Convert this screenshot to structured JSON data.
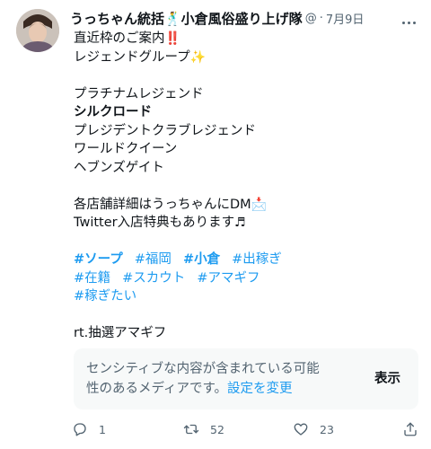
{
  "tweet": {
    "author": {
      "display_name": "うっちゃん統括🕺小倉風俗盛り上げ隊",
      "handle": "@",
      "separator": "·",
      "date": "7月9日"
    },
    "lines": {
      "l1": "直近枠のご案内",
      "l1_emoji": "‼️",
      "l2": "レジェンドグループ",
      "l2_emoji": "✨",
      "l3": "プラチナムレジェンド",
      "l4": "シルクロード",
      "l5": "プレジデントクラブレジェンド",
      "l6": "ワールドクイーン",
      "l7": "ヘブンズゲイト",
      "l8": "各店舗詳細はうっちゃんにDM",
      "l8_emoji": "📩",
      "l9": "Twitter入店特典もあります",
      "l9_emoji": "♬",
      "l10": "rt.抽選アマギフ"
    },
    "hashtags": {
      "row1": [
        "#ソープ",
        "#福岡",
        "#小倉",
        "#出稼ぎ"
      ],
      "row2": [
        "#在籍",
        "#スカウト",
        "#アマギフ"
      ],
      "row3": [
        "#稼ぎたい"
      ]
    },
    "sensitive_notice": {
      "text": "センシティブな内容が含まれている可能性のあるメディアです。",
      "settings_link": "設定を変更",
      "show_label": "表示"
    },
    "actions": {
      "reply_count": "1",
      "retweet_count": "52",
      "like_count": "23"
    }
  },
  "colors": {
    "link": "#1d9bf0",
    "text": "#0f1419",
    "secondary": "#536471",
    "media_bg": "#f7f9f9"
  },
  "icons": [
    "more-icon",
    "reply-icon",
    "retweet-icon",
    "like-icon",
    "share-icon"
  ]
}
